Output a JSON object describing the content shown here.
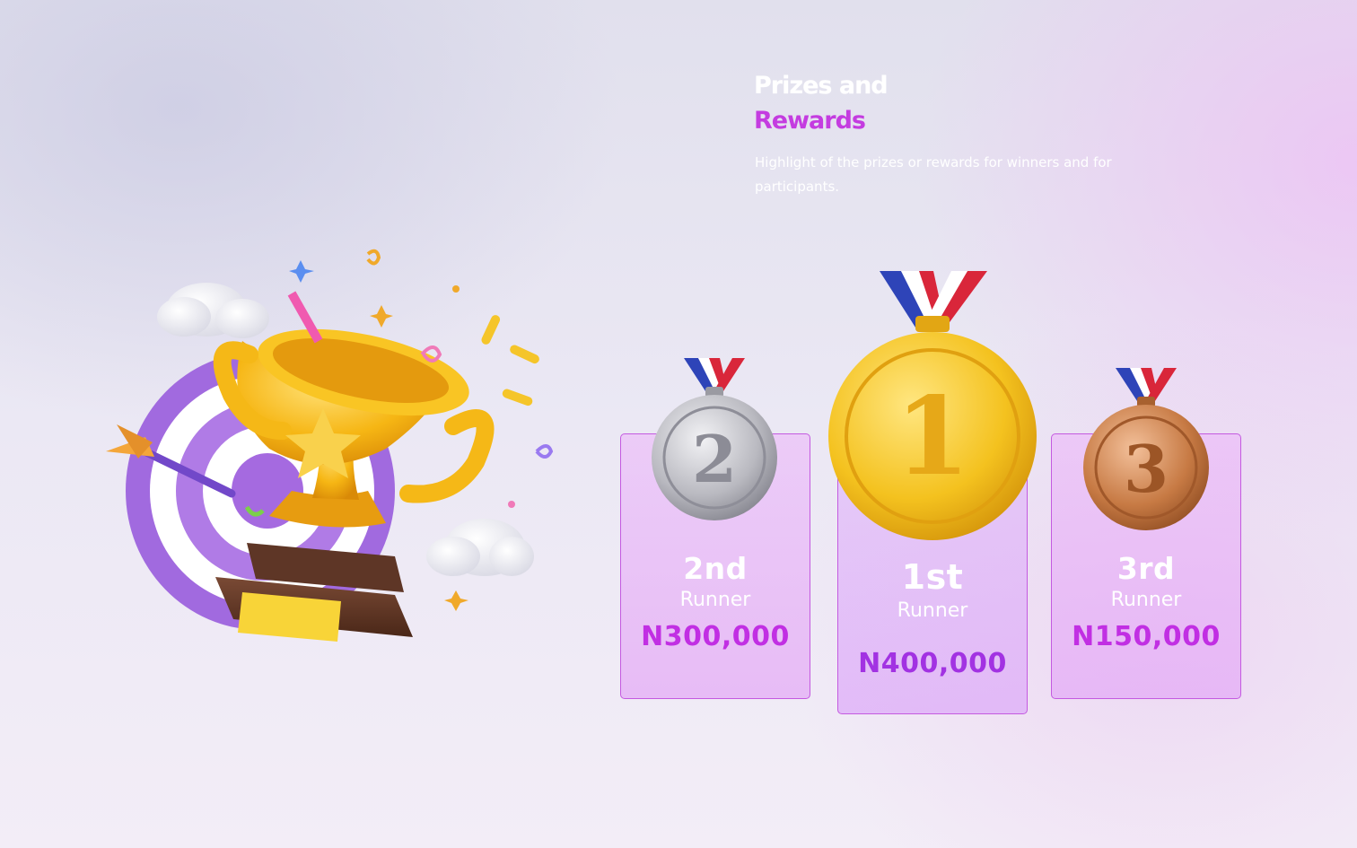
{
  "section": {
    "title_line1": "Prizes and",
    "title_line2": "Rewards",
    "subtitle": "Highlight of the prizes or rewards for winners and for participants."
  },
  "prizes": [
    {
      "place": "2nd",
      "label": "Runner",
      "amount": "N300,000",
      "medal_number": "2",
      "medal": "silver-medal-icon"
    },
    {
      "place": "1st",
      "label": "Runner",
      "amount": "N400,000",
      "medal_number": "1",
      "medal": "gold-medal-icon"
    },
    {
      "place": "3rd",
      "label": "Runner",
      "amount": "N150,000",
      "medal_number": "3",
      "medal": "bronze-medal-icon"
    }
  ],
  "colors": {
    "accent_magenta": "#c43ce0",
    "amount_2nd_3rd": "#c12fe3",
    "amount_1st": "#a232e2",
    "card_border": "#c45ae0",
    "gold": "#f4c21f",
    "silver": "#b8b8be",
    "bronze": "#c77a44"
  }
}
